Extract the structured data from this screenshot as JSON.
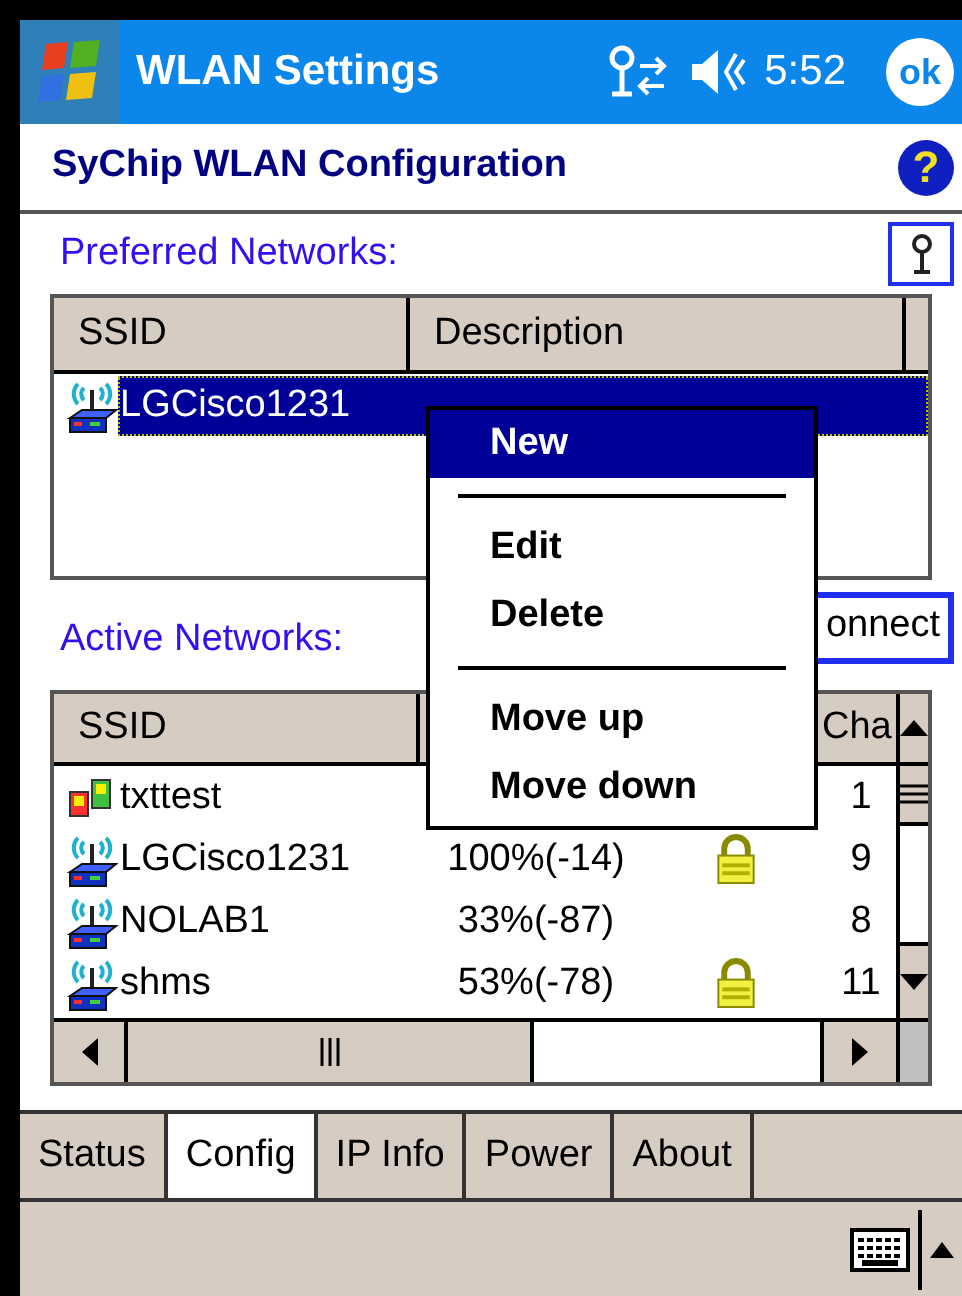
{
  "title_bar": {
    "title": "WLAN Settings",
    "time": "5:52",
    "ok": "ok"
  },
  "header": {
    "title": "SyChip WLAN Configuration",
    "help": "?"
  },
  "preferred": {
    "label": "Preferred Networks:",
    "columns": [
      "SSID",
      "Description"
    ],
    "rows": [
      {
        "ssid": "LGCisco1231",
        "kind": "ap",
        "selected": true
      }
    ]
  },
  "active": {
    "label": "Active Networks:",
    "connect_button": "onnect",
    "columns": [
      "SSID",
      "Cha"
    ],
    "rows": [
      {
        "ssid": "txttest",
        "kind": "adhoc",
        "signal": "",
        "secured": false,
        "channel": "1"
      },
      {
        "ssid": "LGCisco1231",
        "kind": "ap",
        "signal": "100%(-14)",
        "secured": true,
        "channel": "9"
      },
      {
        "ssid": "NOLAB1",
        "kind": "ap",
        "signal": "33%(-87)",
        "secured": false,
        "channel": "8"
      },
      {
        "ssid": "shms",
        "kind": "ap",
        "signal": "53%(-78)",
        "secured": true,
        "channel": "11"
      }
    ]
  },
  "context_menu": [
    {
      "kind": "item",
      "label": "New",
      "selected": true
    },
    {
      "kind": "separator"
    },
    {
      "kind": "item",
      "label": "Edit",
      "selected": false
    },
    {
      "kind": "item",
      "label": "Delete",
      "selected": false
    },
    {
      "kind": "separator"
    },
    {
      "kind": "item",
      "label": "Move up",
      "selected": false
    },
    {
      "kind": "item",
      "label": "Move down",
      "selected": false
    }
  ],
  "tabs": [
    {
      "label": "Status",
      "selected": false
    },
    {
      "label": "Config",
      "selected": true
    },
    {
      "label": "IP Info",
      "selected": false
    },
    {
      "label": "Power",
      "selected": false
    },
    {
      "label": "About",
      "selected": false
    }
  ]
}
